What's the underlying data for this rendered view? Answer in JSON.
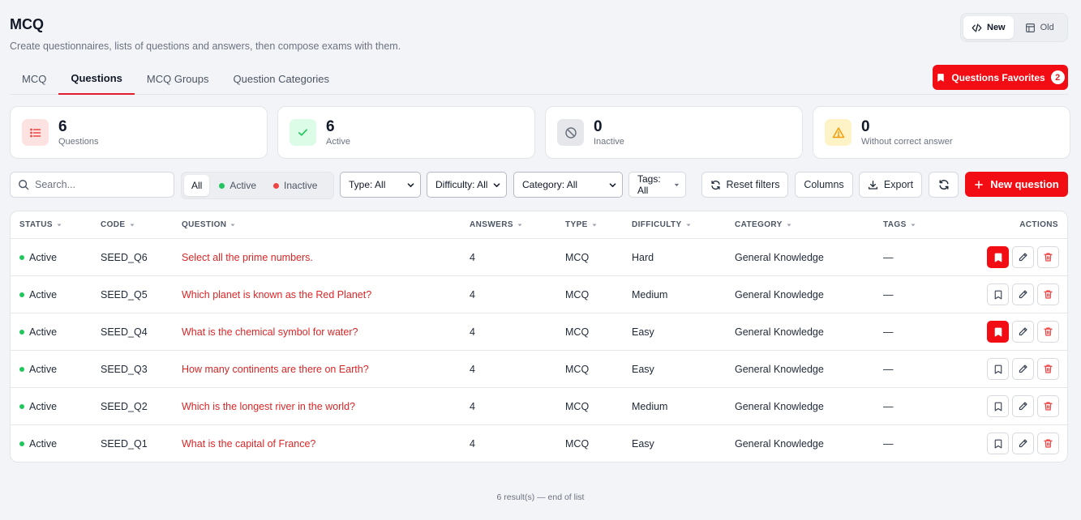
{
  "header": {
    "title": "MCQ",
    "subtitle": "Create questionnaires, lists of questions and answers, then compose exams with them."
  },
  "version_switch": {
    "new_label": "New",
    "old_label": "Old",
    "selected": "New"
  },
  "tabs": [
    {
      "label": "MCQ",
      "active": false
    },
    {
      "label": "Questions",
      "active": true
    },
    {
      "label": "MCQ Groups",
      "active": false
    },
    {
      "label": "Question Categories",
      "active": false
    }
  ],
  "favorites": {
    "label": "Questions Favorites",
    "count": "2"
  },
  "stats": [
    {
      "value": "6",
      "label": "Questions",
      "icon": "list-icon",
      "color": "#ef4444",
      "bg": "#fde2e2"
    },
    {
      "value": "6",
      "label": "Active",
      "icon": "check-icon",
      "color": "#22c55e",
      "bg": "#dcfce7"
    },
    {
      "value": "0",
      "label": "Inactive",
      "icon": "ban-icon",
      "color": "#6b7280",
      "bg": "#e5e7eb"
    },
    {
      "value": "0",
      "label": "Without correct answer",
      "icon": "warning-icon",
      "color": "#f59e0b",
      "bg": "#fef3c7"
    }
  ],
  "filters": {
    "search_placeholder": "Search...",
    "status_segments": [
      {
        "label": "All",
        "active": true
      },
      {
        "label": "Active",
        "active": false,
        "dot_color": "#22c55e"
      },
      {
        "label": "Inactive",
        "active": false,
        "dot_color": "#ef4444"
      }
    ],
    "type": "Type: All",
    "difficulty": "Difficulty: All",
    "category": "Category: All",
    "tags": "Tags: All",
    "reset_label": "Reset filters",
    "columns_label": "Columns",
    "export_label": "Export",
    "new_label": "New question"
  },
  "table": {
    "columns": [
      "STATUS",
      "CODE",
      "QUESTION",
      "ANSWERS",
      "TYPE",
      "DIFFICULTY",
      "CATEGORY",
      "TAGS",
      "ACTIONS"
    ],
    "rows": [
      {
        "status": "Active",
        "code": "SEED_Q6",
        "question": "Select all the prime numbers.",
        "answers": "4",
        "type": "MCQ",
        "difficulty": "Hard",
        "category": "General Knowledge",
        "tags": "—",
        "favorite": true
      },
      {
        "status": "Active",
        "code": "SEED_Q5",
        "question": "Which planet is known as the Red Planet?",
        "answers": "4",
        "type": "MCQ",
        "difficulty": "Medium",
        "category": "General Knowledge",
        "tags": "—",
        "favorite": false
      },
      {
        "status": "Active",
        "code": "SEED_Q4",
        "question": "What is the chemical symbol for water?",
        "answers": "4",
        "type": "MCQ",
        "difficulty": "Easy",
        "category": "General Knowledge",
        "tags": "—",
        "favorite": true
      },
      {
        "status": "Active",
        "code": "SEED_Q3",
        "question": "How many continents are there on Earth?",
        "answers": "4",
        "type": "MCQ",
        "difficulty": "Easy",
        "category": "General Knowledge",
        "tags": "—",
        "favorite": false
      },
      {
        "status": "Active",
        "code": "SEED_Q2",
        "question": "Which is the longest river in the world?",
        "answers": "4",
        "type": "MCQ",
        "difficulty": "Medium",
        "category": "General Knowledge",
        "tags": "—",
        "favorite": false
      },
      {
        "status": "Active",
        "code": "SEED_Q1",
        "question": "What is the capital of France?",
        "answers": "4",
        "type": "MCQ",
        "difficulty": "Easy",
        "category": "General Knowledge",
        "tags": "—",
        "favorite": false
      }
    ]
  },
  "footer": {
    "text": "6 result(s) — end of list"
  },
  "colors": {
    "accent": "#f20c14",
    "active_dot": "#22c55e",
    "question_link": "#dc2626"
  }
}
